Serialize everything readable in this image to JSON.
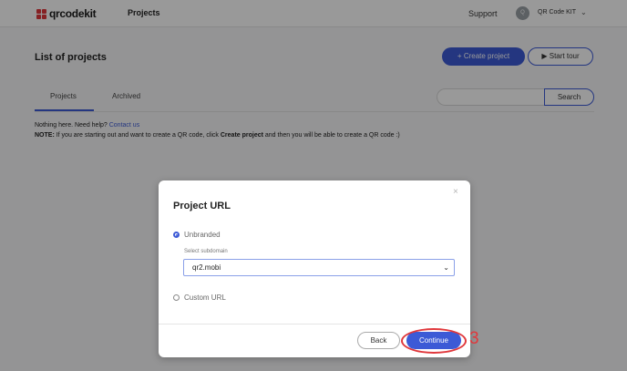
{
  "header": {
    "logo_text": "qrcodekit",
    "nav_projects": "Projects",
    "support": "Support",
    "avatar_initial": "Q",
    "account_name": "QR Code KIT",
    "account_chevron": "⌄"
  },
  "page": {
    "title": "List of projects",
    "create_button": "+ Create project",
    "tour_button": "▶ Start tour",
    "tabs": [
      {
        "label": "Projects",
        "active": true
      },
      {
        "label": "Archived",
        "active": false
      }
    ],
    "search_placeholder": "",
    "search_button": "Search",
    "empty_text": "Nothing here. Need help?",
    "contact_link": "Contact us",
    "note_label": "NOTE:",
    "note_text_1": " If you are starting out and want to create a QR code, click ",
    "note_bold": "Create project",
    "note_text_2": " and then you will be able to create a QR code :)"
  },
  "modal": {
    "title": "Project URL",
    "close": "×",
    "option_unbranded": "Unbranded",
    "unbranded_selected": true,
    "subdomain_label": "Select subdomain",
    "subdomain_value": "qr2.mobi",
    "option_custom": "Custom URL",
    "back_button": "Back",
    "continue_button": "Continue"
  },
  "annotation": {
    "step_number": "3",
    "color": "#e0383c"
  },
  "colors": {
    "accent": "#3c5ad6",
    "brand_red": "#e0383c"
  }
}
